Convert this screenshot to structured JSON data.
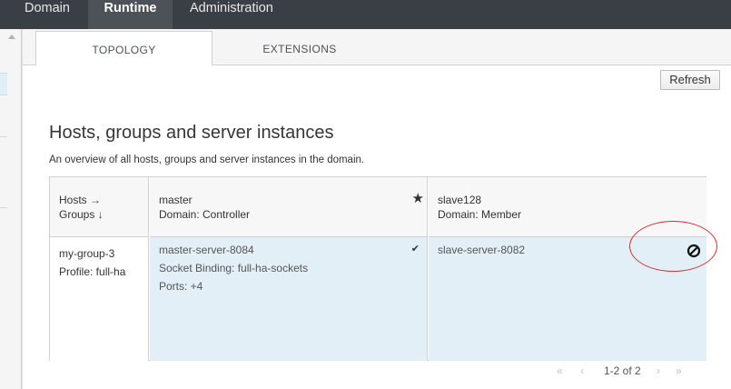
{
  "topnav": {
    "items": [
      {
        "label": "Domain"
      },
      {
        "label": "Runtime",
        "active": true
      },
      {
        "label": "Administration"
      }
    ]
  },
  "tabs": {
    "items": [
      {
        "label": "TOPOLOGY",
        "active": true
      },
      {
        "label": "EXTENSIONS"
      }
    ]
  },
  "toolbar": {
    "refresh_label": "Refresh"
  },
  "main": {
    "title": "Hosts, groups and server instances",
    "description": "An overview of all hosts, groups and server instances in the domain."
  },
  "topology": {
    "corner": {
      "line1": "Hosts →",
      "line2": "Groups ↓"
    },
    "hosts": [
      {
        "name": "master",
        "role": "Domain: Controller",
        "icon": "star-icon"
      },
      {
        "name": "slave128",
        "role": "Domain: Member"
      }
    ],
    "group": {
      "name": "my-group-3",
      "profile": "Profile: full-ha"
    },
    "servers": {
      "master": {
        "name": "master-server-8084",
        "binding": "Socket Binding: full-ha-sockets",
        "ports": "Ports: +4",
        "status_icon": "check-icon"
      },
      "slave": {
        "name": "slave-server-8082",
        "status_icon": "ban-icon"
      }
    }
  },
  "pager": {
    "label": "1-2 of 2",
    "first": "«",
    "prev": "‹",
    "next": "›",
    "last": "»"
  },
  "colors": {
    "topnav_bg": "#393f44",
    "active_nav_bg": "#4d5258",
    "cell_bg": "#e3eff7",
    "annotation": "#d32f2f"
  }
}
